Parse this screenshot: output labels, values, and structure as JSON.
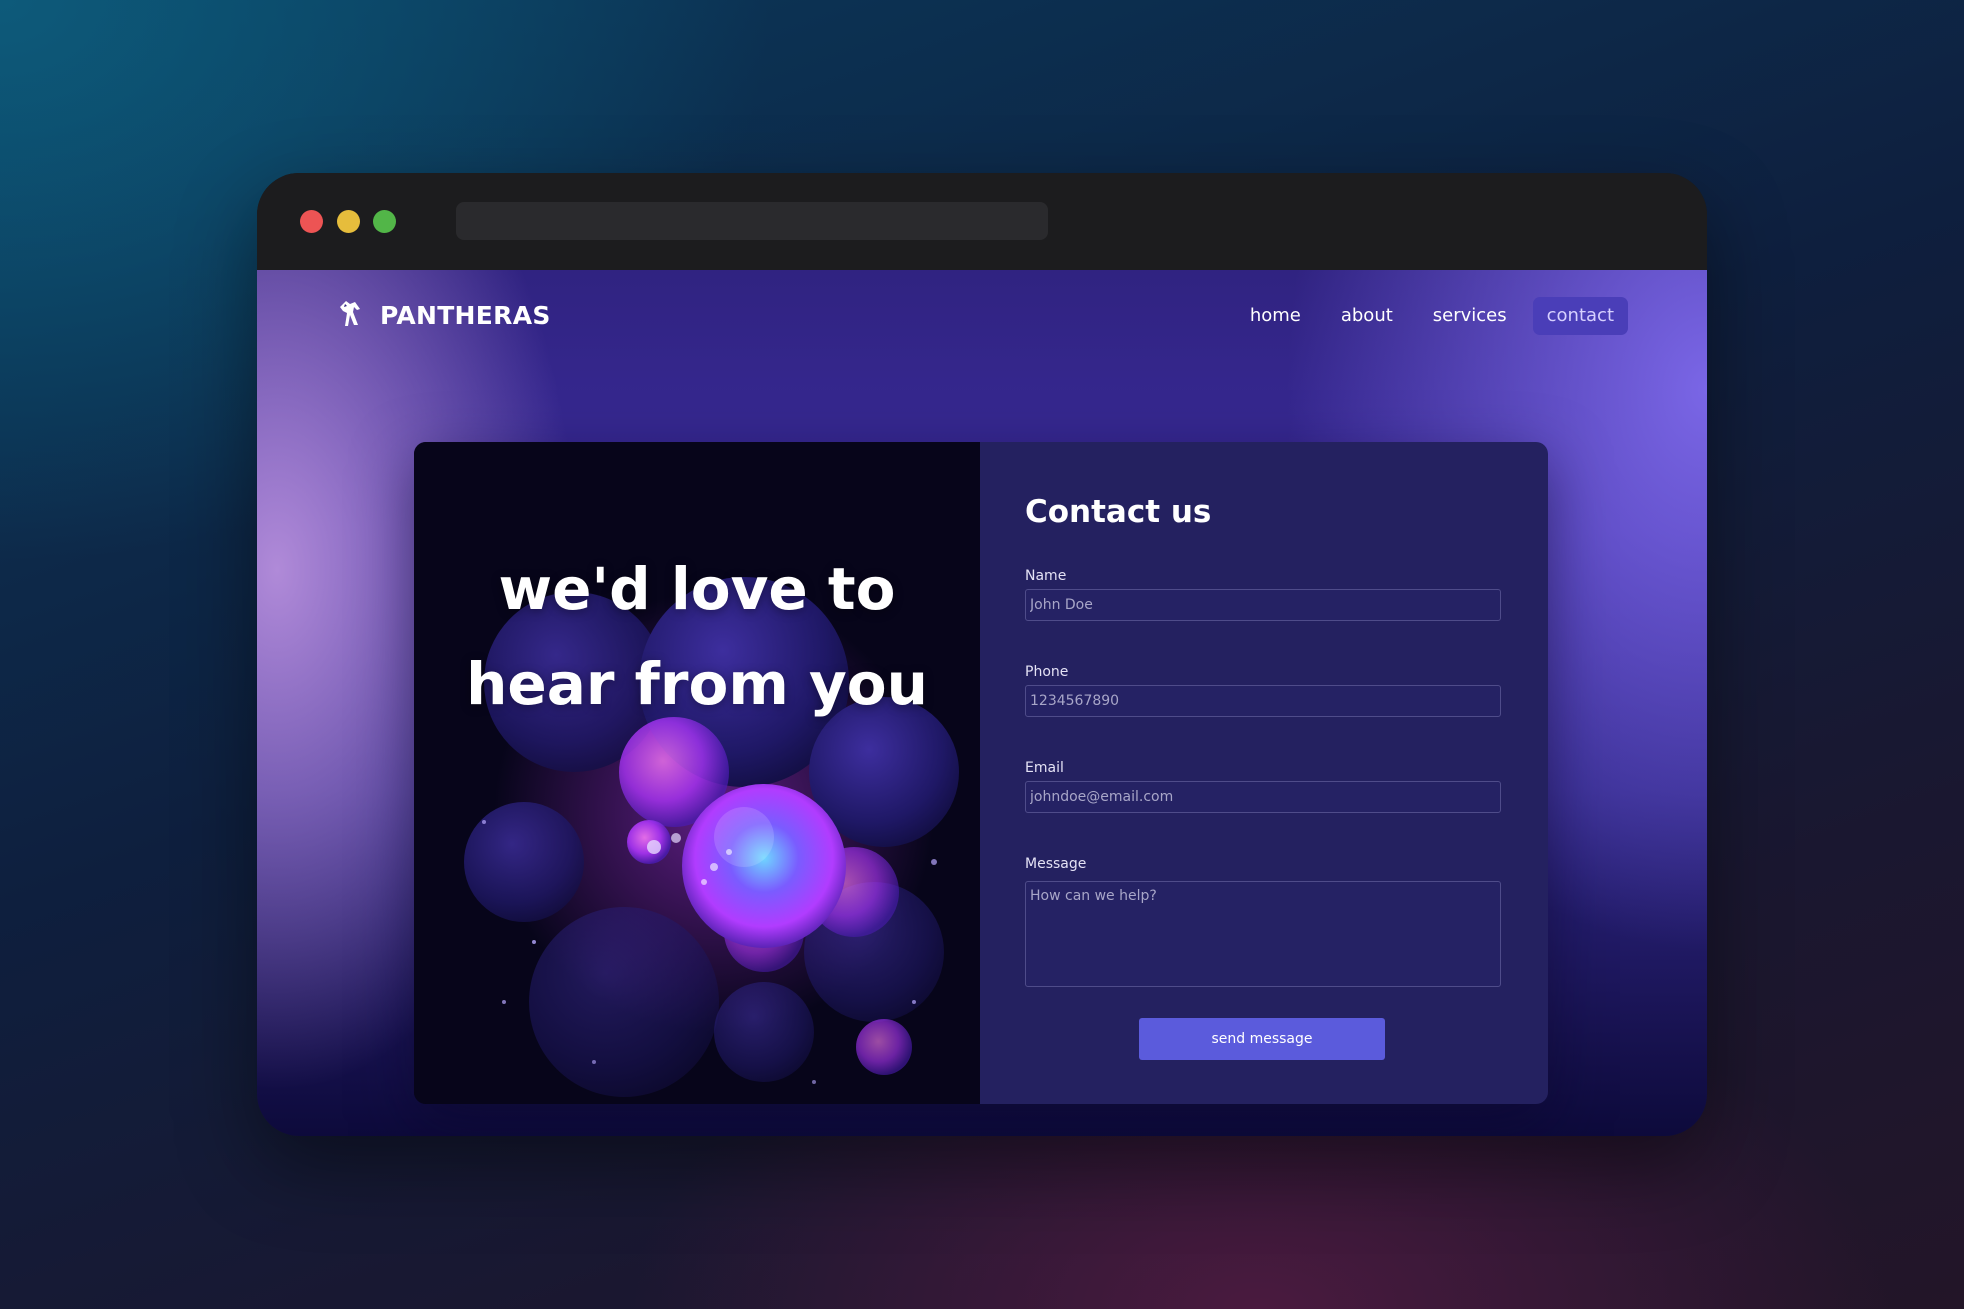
{
  "brand": {
    "name": "PANTHERAS",
    "logo_icon": "panther-icon"
  },
  "nav": {
    "items": [
      {
        "label": "home"
      },
      {
        "label": "about"
      },
      {
        "label": "services"
      },
      {
        "label": "contact",
        "active": true
      }
    ]
  },
  "hero": {
    "line1": "we'd love to",
    "line2": "hear from you"
  },
  "form": {
    "title": "Contact us",
    "name": {
      "label": "Name",
      "placeholder": "John Doe"
    },
    "phone": {
      "label": "Phone",
      "placeholder": "1234567890"
    },
    "email": {
      "label": "Email",
      "placeholder": "johndoe@email.com"
    },
    "message": {
      "label": "Message",
      "placeholder": "How can we help?"
    },
    "submit_label": "send message"
  },
  "colors": {
    "accent": "#5b5bdc",
    "form_bg": "#242160",
    "nav_active_bg": "#4a3eb8",
    "traffic_red": "#ed5454",
    "traffic_yellow": "#e6bd3c",
    "traffic_green": "#52b648"
  }
}
